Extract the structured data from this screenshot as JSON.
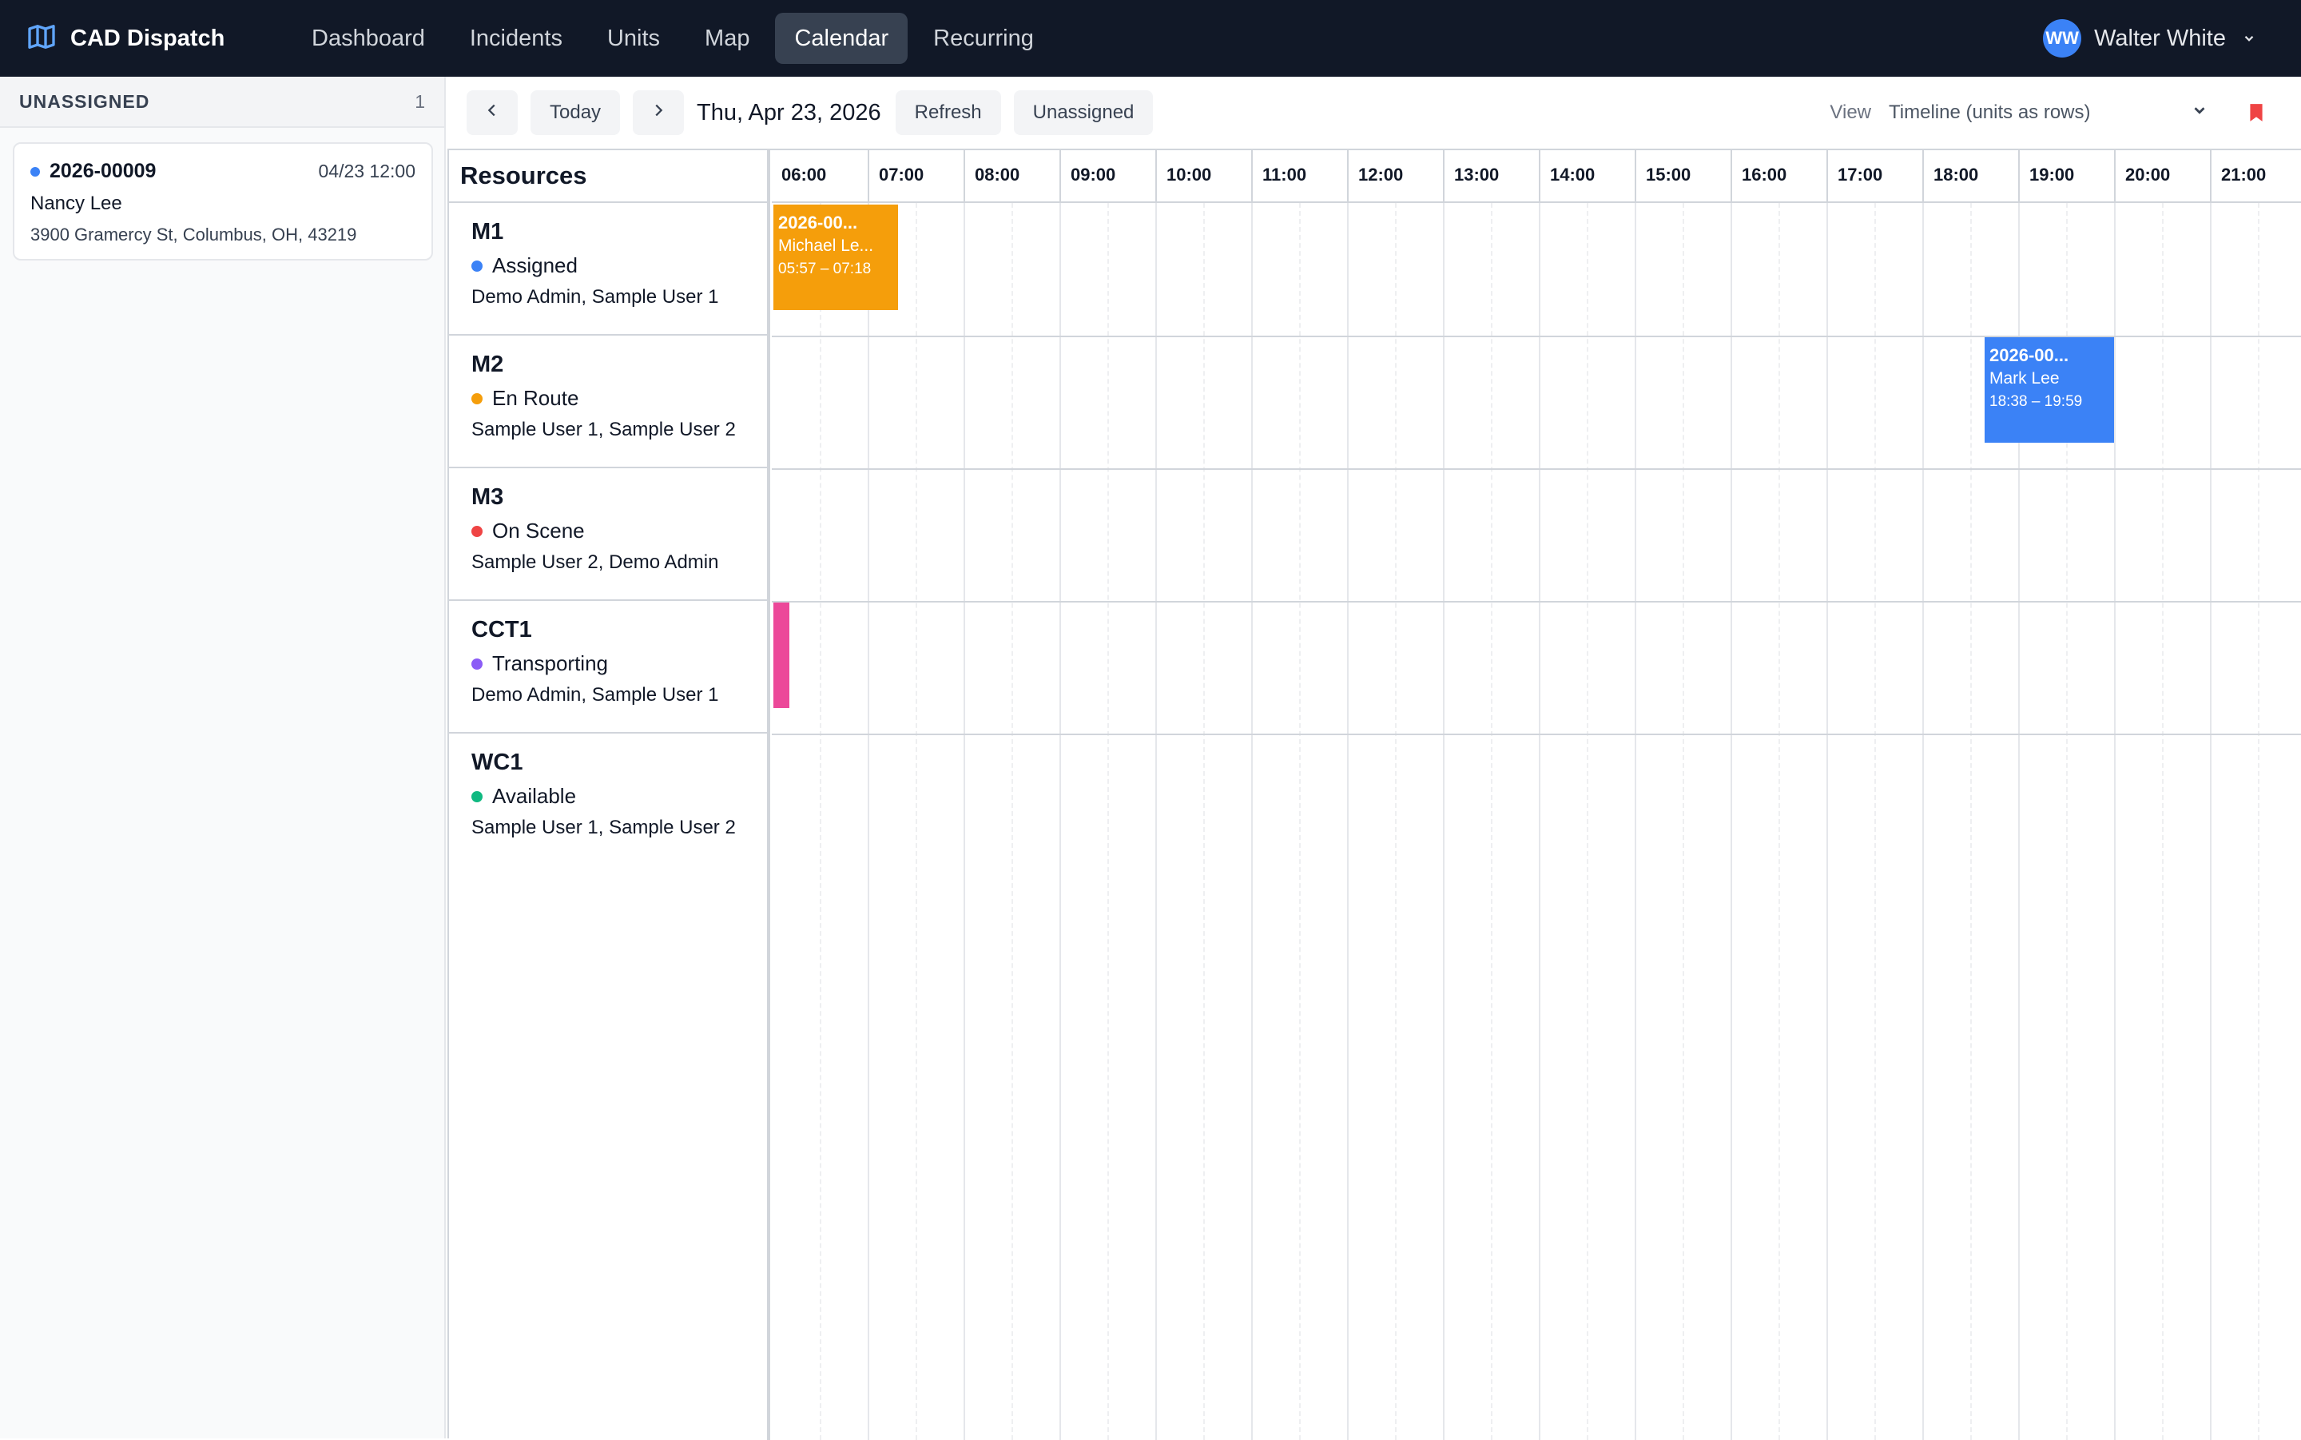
{
  "app": {
    "title": "CAD Dispatch"
  },
  "nav": {
    "items": [
      {
        "label": "Dashboard",
        "active": false
      },
      {
        "label": "Incidents",
        "active": false
      },
      {
        "label": "Units",
        "active": false
      },
      {
        "label": "Map",
        "active": false
      },
      {
        "label": "Calendar",
        "active": true
      },
      {
        "label": "Recurring",
        "active": false
      }
    ]
  },
  "user": {
    "initials": "WW",
    "name": "Walter White"
  },
  "unassigned": {
    "title": "UNASSIGNED",
    "count": "1",
    "items": [
      {
        "id": "2026-00009",
        "time": "04/23 12:00",
        "name": "Nancy Lee",
        "address": "3900 Gramercy St, Columbus, OH, 43219",
        "dot_color": "#3b82f6"
      }
    ]
  },
  "toolbar": {
    "today_label": "Today",
    "date": "Thu, Apr 23, 2026",
    "refresh_label": "Refresh",
    "unassigned_label": "Unassigned",
    "view_label": "View",
    "view_value": "Timeline (units as rows)"
  },
  "calendar": {
    "resources_header": "Resources",
    "hours": [
      "06:00",
      "07:00",
      "08:00",
      "09:00",
      "10:00",
      "11:00",
      "12:00",
      "13:00",
      "14:00",
      "15:00",
      "16:00",
      "17:00",
      "18:00",
      "19:00",
      "20:00",
      "21:00"
    ],
    "resources": [
      {
        "name": "M1",
        "status": "Assigned",
        "status_color": "#3b82f6",
        "crew": "Demo Admin, Sample User 1"
      },
      {
        "name": "M2",
        "status": "En Route",
        "status_color": "#f59e0b",
        "crew": "Sample User 1, Sample User 2"
      },
      {
        "name": "M3",
        "status": "On Scene",
        "status_color": "#ef4444",
        "crew": "Sample User 2, Demo Admin"
      },
      {
        "name": "CCT1",
        "status": "Transporting",
        "status_color": "#8b5cf6",
        "crew": "Demo Admin, Sample User 1"
      },
      {
        "name": "WC1",
        "status": "Available",
        "status_color": "#10b981",
        "crew": "Sample User 1, Sample User 2"
      }
    ],
    "events": [
      {
        "row": 0,
        "start": "05:57",
        "end": "07:18",
        "title": "2026-00...",
        "name": "Michael Le...",
        "time_text": "05:57 – 07:18",
        "color": "#f59e0b"
      },
      {
        "row": 1,
        "start": "18:38",
        "end": "19:59",
        "title": "2026-00...",
        "name": "Mark Lee",
        "time_text": "18:38 – 19:59",
        "color": "#3b82f6"
      },
      {
        "row": 3,
        "start": "06:00",
        "end": "06:10",
        "title": "",
        "name": "",
        "time_text": "",
        "color": "#ec4899"
      }
    ]
  },
  "colors": {
    "nav_bg": "#111827",
    "accent": "#3b82f6",
    "bookmark": "#ef4444"
  }
}
